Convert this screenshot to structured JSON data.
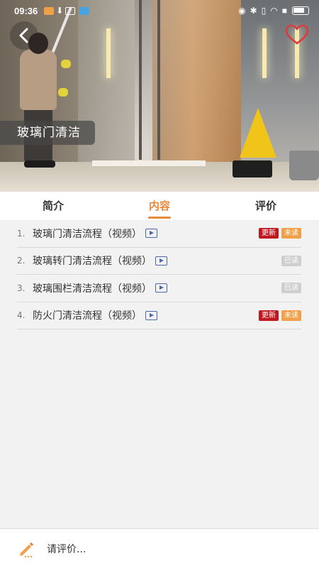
{
  "status_bar": {
    "time": "09:36"
  },
  "header": {
    "title": "玻璃门清洁",
    "back_icon": "chevron-left-icon",
    "favorite_icon": "heart-outline-icon",
    "favorite_color": "#e0393e"
  },
  "tabs": [
    {
      "label": "简介",
      "active": false
    },
    {
      "label": "内容",
      "active": true
    },
    {
      "label": "评价",
      "active": false
    }
  ],
  "accent_color": "#e8893a",
  "items": [
    {
      "index": "1.",
      "title": "玻璃门清洁流程（视频）",
      "badges": [
        "更新",
        "未读"
      ]
    },
    {
      "index": "2.",
      "title": "玻璃转门清洁流程（视频）",
      "badges": [
        "已读"
      ]
    },
    {
      "index": "3.",
      "title": "玻璃围栏清洁流程（视频）",
      "badges": [
        "已读"
      ]
    },
    {
      "index": "4.",
      "title": "防火门清洁流程（视频）",
      "badges": [
        "更新",
        "未读"
      ]
    }
  ],
  "comment_bar": {
    "placeholder": "请评价...",
    "icon": "pencil-icon"
  }
}
